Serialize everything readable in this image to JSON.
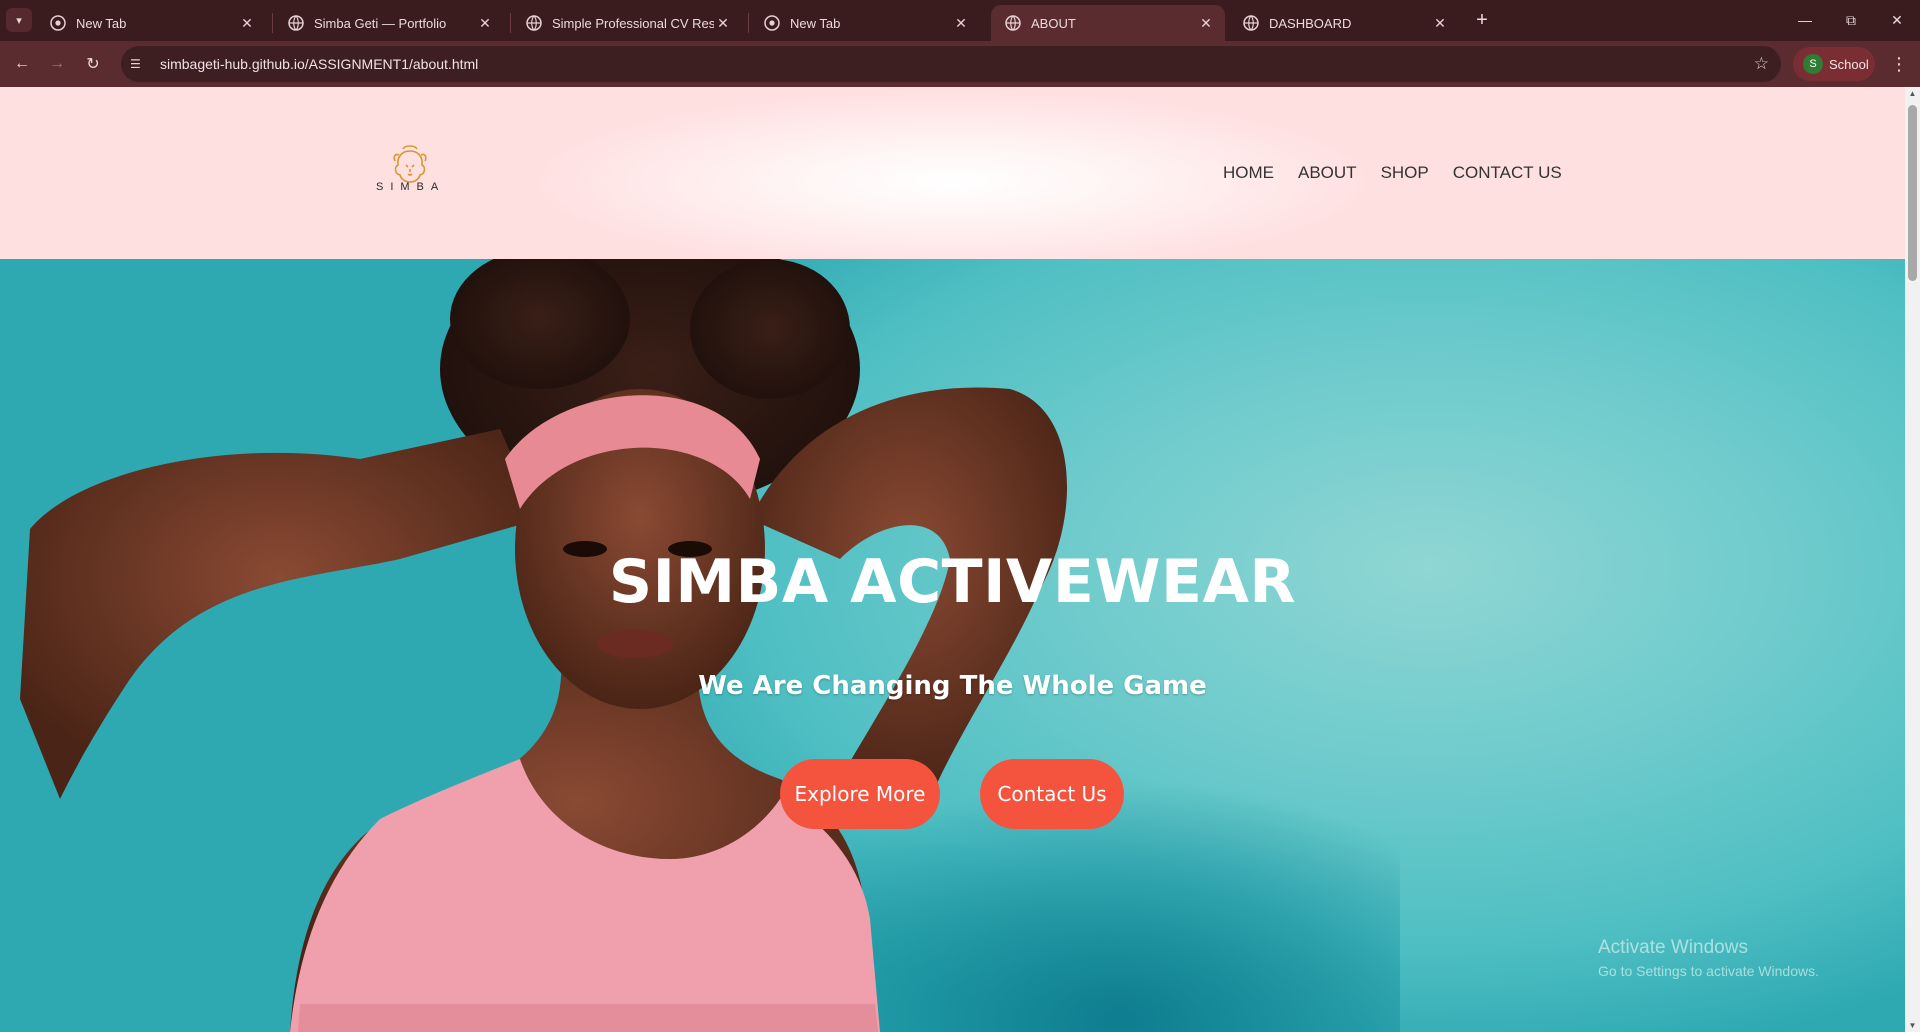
{
  "browser": {
    "tabs": [
      {
        "title": "New Tab",
        "favicon": "chrome-icon",
        "active": false
      },
      {
        "title": "Simba Geti — Portfolio",
        "favicon": "globe-icon",
        "active": false
      },
      {
        "title": "Simple Professional CV Resume",
        "favicon": "globe-icon",
        "active": false
      },
      {
        "title": "New Tab",
        "favicon": "chrome-icon",
        "active": false
      },
      {
        "title": "ABOUT",
        "favicon": "globe-icon",
        "active": true
      },
      {
        "title": "DASHBOARD",
        "favicon": "globe-icon",
        "active": false
      }
    ],
    "url": "simbageti-hub.github.io/ASSIGNMENT1/about.html",
    "profile": {
      "initial": "S",
      "label": "School"
    }
  },
  "site": {
    "logo_text": "SIMBA",
    "nav": [
      "HOME",
      "ABOUT",
      "SHOP",
      "CONTACT US"
    ],
    "hero": {
      "title": "SIMBA ACTIVEWEAR",
      "subtitle": "We Are Changing The Whole Game",
      "explore_label": "Explore More",
      "contact_label": "Contact Us"
    }
  },
  "os_watermark": {
    "line1": "Activate Windows",
    "line2": "Go to Settings to activate Windows."
  },
  "colors": {
    "accent_button": "#f4543d",
    "hero_background": "#6fcbcc",
    "header_background": "#ffe0e1",
    "chrome_frame": "#3a1c1f"
  }
}
